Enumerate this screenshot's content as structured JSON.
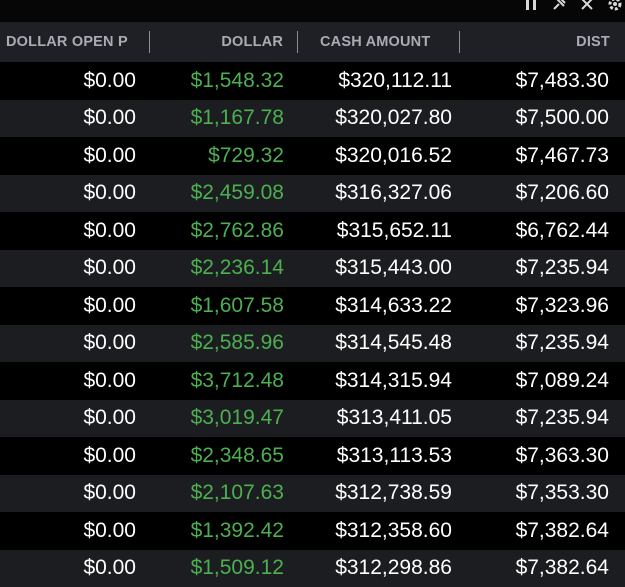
{
  "columns": [
    {
      "label": "DOLLAR OPEN P"
    },
    {
      "label": "DOLLAR"
    },
    {
      "label": "CASH AMOUNT"
    },
    {
      "label": "DIST"
    }
  ],
  "rows": [
    [
      "$0.00",
      "$1,548.32",
      "$320,112.11",
      "$7,483.30"
    ],
    [
      "$0.00",
      "$1,167.78",
      "$320,027.80",
      "$7,500.00"
    ],
    [
      "$0.00",
      "$729.32",
      "$320,016.52",
      "$7,467.73"
    ],
    [
      "$0.00",
      "$2,459.08",
      "$316,327.06",
      "$7,206.60"
    ],
    [
      "$0.00",
      "$2,762.86",
      "$315,652.11",
      "$6,762.44"
    ],
    [
      "$0.00",
      "$2,236.14",
      "$315,443.00",
      "$7,235.94"
    ],
    [
      "$0.00",
      "$1,607.58",
      "$314,633.22",
      "$7,323.96"
    ],
    [
      "$0.00",
      "$2,585.96",
      "$314,545.48",
      "$7,235.94"
    ],
    [
      "$0.00",
      "$3,712.48",
      "$314,315.94",
      "$7,089.24"
    ],
    [
      "$0.00",
      "$3,019.47",
      "$313,411.05",
      "$7,235.94"
    ],
    [
      "$0.00",
      "$2,348.65",
      "$313,113.53",
      "$7,363.30"
    ],
    [
      "$0.00",
      "$2,107.63",
      "$312,738.59",
      "$7,353.30"
    ],
    [
      "$0.00",
      "$1,392.42",
      "$312,358.60",
      "$7,382.64"
    ],
    [
      "$0.00",
      "$1,509.12",
      "$312,298.86",
      "$7,382.64"
    ]
  ],
  "topbar": {
    "icons": [
      "pause-icon",
      "pin-icon",
      "close-icon",
      "gear-icon"
    ]
  },
  "colors": {
    "background": "#000000",
    "row_alt": "#1c1d21",
    "header_bg": "#1f2025",
    "header_text": "#a9acb5",
    "value_text": "#ffffff",
    "positive_text": "#4caf50"
  }
}
